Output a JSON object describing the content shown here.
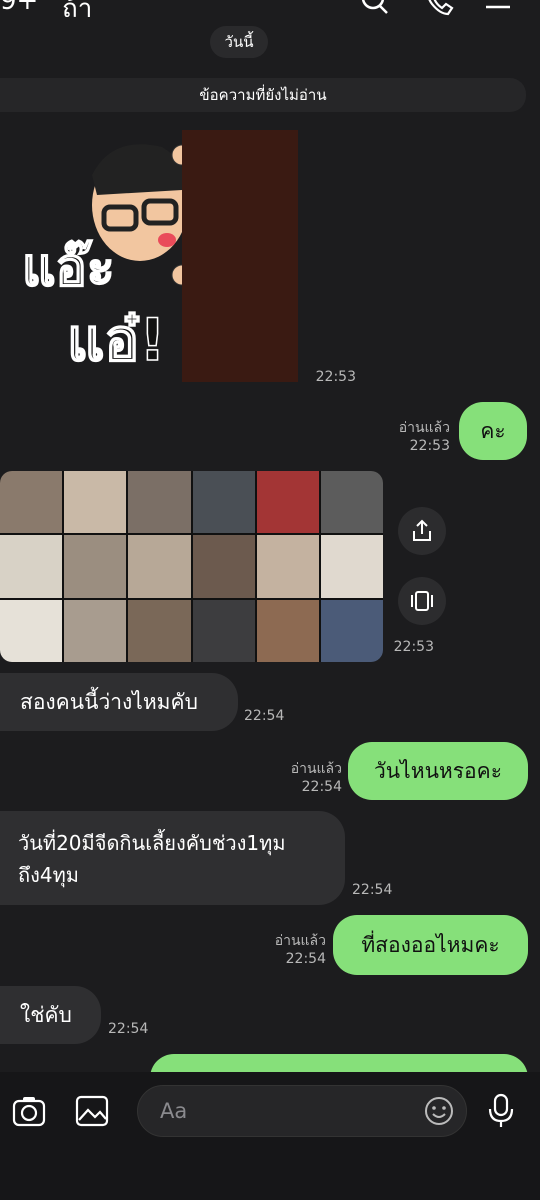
{
  "status": {
    "carrier": "9+",
    "carrier_right": "ถ้า"
  },
  "date_pill": "วันนี้",
  "unread_label": "ข้อความที่ยังไม่อ่าน",
  "messages": [
    {
      "side": "in",
      "kind": "sticker",
      "time": "22:53"
    },
    {
      "side": "out",
      "text": "คะ",
      "read": "อ่านแล้ว",
      "time": "22:53"
    },
    {
      "side": "in",
      "kind": "image",
      "time": "22:53"
    },
    {
      "side": "in",
      "text": "สองคนนี้ว่างไหมคับ",
      "time": "22:54"
    },
    {
      "side": "out",
      "text": "วันไหนหรอคะ",
      "read": "อ่านแล้ว",
      "time": "22:54"
    },
    {
      "side": "in",
      "text_line1": "วันที่20มีจีดกินเลี้ยงคับช่วง1ทุม",
      "text_line2": "ถึง4ทุม",
      "time": "22:54"
    },
    {
      "side": "out",
      "text": "ที่สองออไหมคะ",
      "read": "อ่านแล้ว",
      "time": "22:54"
    },
    {
      "side": "in",
      "text": "ใช่คับ",
      "time": "22:54"
    }
  ],
  "composer": {
    "placeholder": "Aa"
  },
  "icons": [
    "search-icon",
    "phone-icon",
    "menu-icon",
    "share-icon",
    "album-icon",
    "camera-icon",
    "image-icon",
    "emoji-icon",
    "mic-icon"
  ],
  "colors": {
    "background": "#1c1c1e",
    "bubble_out": "#86e07a",
    "bubble_in": "#2f2f31"
  }
}
